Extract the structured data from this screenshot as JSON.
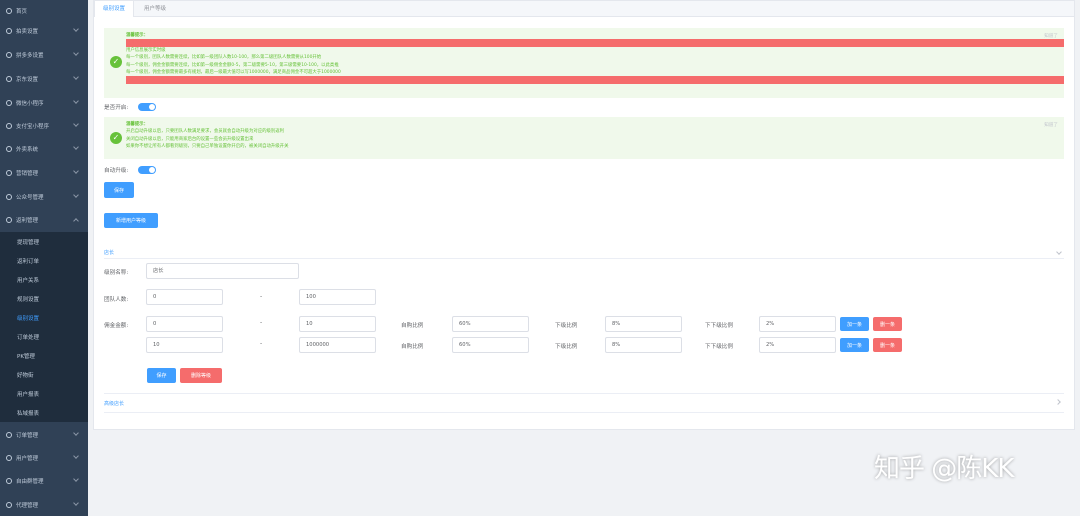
{
  "sidebar": {
    "items": [
      {
        "label": "首页",
        "icon": "home-icon"
      },
      {
        "label": "拍卖设置",
        "icon": "auction-icon"
      },
      {
        "label": "拼多多设置",
        "icon": "shop-icon"
      },
      {
        "label": "京东设置",
        "icon": "cart-icon"
      },
      {
        "label": "微信小程序",
        "icon": "wechat-icon"
      },
      {
        "label": "支付宝小程序",
        "icon": "alipay-icon"
      },
      {
        "label": "外卖系统",
        "icon": "delivery-icon"
      },
      {
        "label": "营销管理",
        "icon": "marketing-icon"
      },
      {
        "label": "公众号管理",
        "icon": "account-icon"
      },
      {
        "label": "返利管理",
        "icon": "rebate-icon"
      }
    ],
    "rebate_sub": [
      "提现管理",
      "返利订单",
      "用户关系",
      "规则设置",
      "级别设置",
      "订单处理",
      "PK管理",
      "好物街",
      "用户报表",
      "私域报表"
    ],
    "bottom_items": [
      {
        "label": "订单管理",
        "icon": "order-icon"
      },
      {
        "label": "用户管理",
        "icon": "user-icon"
      },
      {
        "label": "自由群管理",
        "icon": "group-icon"
      },
      {
        "label": "代理管理",
        "icon": "agent-icon"
      }
    ]
  },
  "tabs": [
    "级别设置",
    "用户等级"
  ],
  "alert1": {
    "title": "温馨提示：",
    "red_line": "不懂设置，点击看教程",
    "lines": [
      "用户信息展示实时级",
      "每一个级别，团队人数需要连续，比如第一级团队人数10-100，那么第二级团队人数需要从100开始",
      "每一个级别，佣金金额需要连续，比如第一级佣金金额0-5，第二级需要5-10，第三级需要10-100，以此类推",
      "每一个级别，佣金金额需要最多有规划，最后一级最大值可以写1000000，满足商品佣金不可超大于1000000"
    ],
    "red_bottom": "佣金金额和团队人数最大写1000000，否则会出错，团队数量和佣金奖励的佣金不会超过1000000！",
    "close": "知道了"
  },
  "enabled_label": "是否开启:",
  "alert2": {
    "title": "温馨提示：",
    "lines": [
      "开启自动升级以后，只要团队人数满足要求，会员就会自动升级为对应的级别返利",
      "关闭自动升级以后，只能用商家后台的设置一些会员升级设置出来",
      "如果你不想让所有人都看到级别，只要自己单独设置你开启的，被关闭自动升级开关"
    ],
    "close": "知道了"
  },
  "auto_label": "自动升级:",
  "save_label": "保存",
  "add_level_label": "新增用户等级",
  "section_title": "店长",
  "level_name_label": "级别名称:",
  "level_name_value": "店长",
  "team_label": "团队人数:",
  "team_min": "0",
  "team_max": "100",
  "commission_label": "佣金金额:",
  "dash": "-",
  "rows": [
    {
      "min": "0",
      "max": "10",
      "self_label": "自购比例",
      "self": "60%",
      "sub_label": "下级比例",
      "sub": "8%",
      "subsub_label": "下下级比例",
      "subsub": "2%",
      "add": "加一条",
      "del": "删一条"
    },
    {
      "min": "10",
      "max": "1000000",
      "self_label": "自购比例",
      "self": "60%",
      "sub_label": "下级比例",
      "sub": "8%",
      "subsub_label": "下下级比例",
      "subsub": "2%",
      "add": "加一条",
      "del": "删一条"
    }
  ],
  "save2_label": "保存",
  "delete_level_label": "删除等级",
  "advanced_label": "高级店长",
  "watermark": "知乎 @陈KK",
  "colors": {
    "sidebar": "#304156",
    "accent": "#409eff",
    "danger": "#f56c6c",
    "success": "#67c23a"
  }
}
